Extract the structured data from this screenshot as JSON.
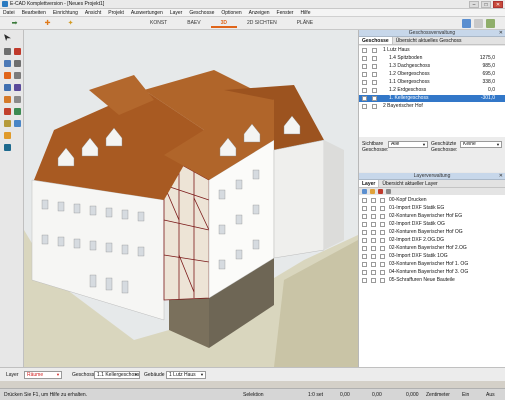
{
  "window": {
    "title": "E-CAD Komplettversion - [Neues Projekt1]",
    "buttons": [
      "–",
      "□",
      "✕"
    ]
  },
  "menu": [
    "Datei",
    "Bearbeiten",
    "Einrichtung",
    "Ansicht",
    "Projekt",
    "Auswertungen",
    "Layer",
    "Geschosse",
    "Optionen",
    "Anzeigen",
    "Fenster",
    "Hilfe"
  ],
  "view_tabs": [
    "KONST",
    "BAEV",
    "3D",
    "2D SICHTEN",
    "PLÄNE"
  ],
  "active_view_tab": "3D",
  "floor_panel": {
    "header": "Geschossverwaltung",
    "tabs": [
      "Geschosse",
      "Übersicht aktuelles Geschoss"
    ],
    "rows": [
      {
        "label": "1 Lutz Haus",
        "value": ""
      },
      {
        "label": "1.4 Spitzboden",
        "value": "1275,0"
      },
      {
        "label": "1.3 Dachgeschoss",
        "value": "985,0"
      },
      {
        "label": "1.2 Obergeschoss",
        "value": "695,0"
      },
      {
        "label": "1.1 Obergeschoss",
        "value": "338,0"
      },
      {
        "label": "1.2 Erdgeschoss",
        "value": "0,0"
      },
      {
        "label": "1. Kellergeschoss",
        "value": "-301,0"
      },
      {
        "label": "2 Bayerischer Hof",
        "value": ""
      }
    ],
    "selected_index": 6,
    "visible_label": "Sichtbare Geschosse:",
    "visible_value": "Alle",
    "protected_label": "Geschützte Geschosse:",
    "protected_value": "Keine"
  },
  "layer_panel": {
    "header": "Layerverwaltung",
    "tabs": [
      "Layer",
      "Übersicht aktueller Layer"
    ],
    "rows": [
      "00-Kopf Drucken",
      "01-Import DXF Statik EG",
      "02-Konturen Bayerischer Hof EG",
      "02-Import DXF Statik OG",
      "02-Konturen Bayerischer Hof OG",
      "02-Import DXF 2.OG.DG",
      "02-Konturen Bayerischer Hof 2.OG",
      "03-Import DXF Statik 1OG",
      "03-Konturen Bayerischer Hof 1. OG",
      "04-Konturen Bayerischer Hof 3. OG",
      "05-Schraffuren Neue Bauteile"
    ]
  },
  "bottom_bar": {
    "layer_label": "Layer",
    "layer_value": "Räume",
    "floor_label": "Geschoss",
    "floor_value": "1.1 Kellergeschoss",
    "building_label": "Gebäude",
    "building_value": "1 Lutz Haus"
  },
  "status": {
    "hint": "Drücken Sie F1, um Hilfe zu erhalten.",
    "mode": "Selektion",
    "scale": "1:0 set",
    "value": "0,00",
    "zoom": "0,00",
    "coordinate": "0,000",
    "unit": "Zentimeter",
    "x": "Ein",
    "y": "Aus"
  },
  "colors": {
    "accent": "#e0651a",
    "selection": "#3277c8",
    "roof": "#a85a22",
    "wall": "#f6f6f4",
    "timber": "#7a1818",
    "stone": "#6e6655"
  }
}
